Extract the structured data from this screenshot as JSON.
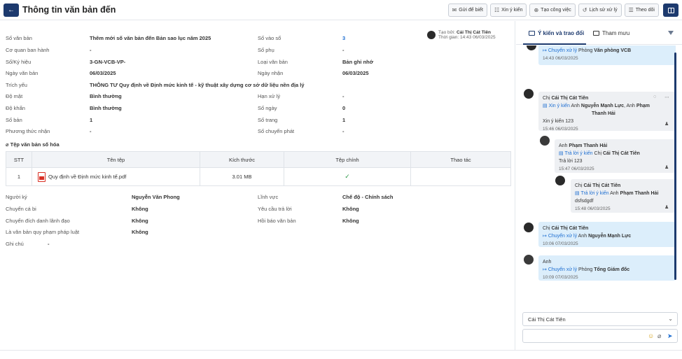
{
  "header": {
    "back_icon": "arrow-left-icon",
    "title": "Thông tin văn bản đến",
    "buttons": [
      {
        "label": "Gửi để biết",
        "icon": "send-icon"
      },
      {
        "label": "Xin ý kiến",
        "icon": "opinion-icon"
      },
      {
        "label": "Tạo công việc",
        "icon": "task-icon"
      },
      {
        "label": "Lịch sử xử lý",
        "icon": "history-icon"
      },
      {
        "label": "Theo dõi",
        "icon": "follow-icon"
      }
    ]
  },
  "creator": {
    "created_by_label": "Tạo bởi:",
    "created_by": "Cái Thị Cát Tiên",
    "time_label": "Thời gian:",
    "time": "14:43 06/03/2025"
  },
  "fields": {
    "so_van_ban": {
      "label": "Số văn bản",
      "value": "Thêm mới số văn bản đến Bản sao lục năm 2025"
    },
    "so_vao_so": {
      "label": "Số vào sổ",
      "value": "3"
    },
    "co_quan": {
      "label": "Cơ quan ban hành",
      "value": "-"
    },
    "so_phu": {
      "label": "Số phụ",
      "value": "-"
    },
    "ky_hieu": {
      "label": "Số/Ký hiệu",
      "value": "3-GN-VCB-VP-"
    },
    "loai_vb": {
      "label": "Loại văn bản",
      "value": "Bản ghi nhớ"
    },
    "ngay_vb": {
      "label": "Ngày văn bản",
      "value": "06/03/2025"
    },
    "ngay_nhan": {
      "label": "Ngày nhận",
      "value": "06/03/2025"
    },
    "trich_yeu": {
      "label": "Trích yếu",
      "value": "THÔNG TƯ Quy định về Định mức kinh tế - kỹ thuật xây dựng cơ sở dữ liệu nền địa lý"
    },
    "do_mat": {
      "label": "Độ mật",
      "value": "Bình thường"
    },
    "han_xu_ly": {
      "label": "Hạn xử lý",
      "value": "-"
    },
    "do_khan": {
      "label": "Độ khẩn",
      "value": "Bình thường"
    },
    "so_ngay": {
      "label": "Số ngày",
      "value": "0"
    },
    "so_ban": {
      "label": "Số bản",
      "value": "1"
    },
    "so_trang": {
      "label": "Số trang",
      "value": "1"
    },
    "phuong_thuc": {
      "label": "Phương thức nhận",
      "value": "-"
    },
    "so_chuyen_phat": {
      "label": "Số chuyển phát",
      "value": "-"
    },
    "nguoi_ky": {
      "label": "Người ký",
      "value": "Nguyễn Văn Phong"
    },
    "linh_vuc": {
      "label": "Lĩnh vực",
      "value": "Chế độ - Chính sách"
    },
    "chuyen_ca_bi": {
      "label": "Chuyển cá bi",
      "value": "Không"
    },
    "yeu_cau_tra_loi": {
      "label": "Yêu cầu trả lời",
      "value": "Không"
    },
    "chuyen_dich_danh": {
      "label": "Chuyển đích danh lãnh đạo",
      "value": "Không"
    },
    "hoi_bao": {
      "label": "Hồi báo văn bản",
      "value": "Không"
    },
    "qppl": {
      "label": "Là văn bản quy phạm pháp luật",
      "value": "Không"
    },
    "ghi_chu": {
      "label": "Ghi chú",
      "value": "-"
    }
  },
  "attachments": {
    "title": "Tệp văn bản số hóa",
    "columns": [
      "STT",
      "Tên tệp",
      "Kích thước",
      "Tệp chính",
      "Thao tác"
    ],
    "rows": [
      {
        "stt": "1",
        "name": "Quy định về Định mức kinh tế.pdf",
        "size": "3.01 MB",
        "main": true,
        "icon": "pdf-icon"
      }
    ]
  },
  "right_panel": {
    "tabs": [
      {
        "label": "Ý kiến và trao đổi",
        "active": true,
        "icon": "comment-icon"
      },
      {
        "label": "Tham mưu",
        "active": false,
        "icon": "advise-icon"
      }
    ],
    "messages": [
      {
        "sender": "",
        "action": "Chuyển xử lý",
        "target_prefix": "Phòng",
        "target": "Văn phòng VCB",
        "body": "",
        "time": "14:43 06/03/2025"
      },
      {
        "sender_prefix": "Chị",
        "sender": "Cái Thị Cát Tiên",
        "action": "Xin ý kiến",
        "target": "Anh Nguyễn Mạnh Lực, Anh Phạm Thanh Hải",
        "t1a": "Anh",
        "t1b": "Nguyễn Mạnh Lực",
        "t2a": "Anh",
        "t2b": "Phạm",
        "t2c": "Thanh Hải",
        "body": "Xin ý kiến 123",
        "time": "15:46 06/03/2025"
      },
      {
        "sender_prefix": "Anh",
        "sender": "Phạm Thanh Hải",
        "action": "Trả lời ý kiến",
        "target_prefix": "Chị",
        "target": "Cái Thị Cát Tiên",
        "body": "Trả lời 123",
        "time": "15:47 06/03/2025"
      },
      {
        "sender_prefix": "Chị",
        "sender": "Cái Thị Cát Tiên",
        "action": "Trả lời ý kiến",
        "target_prefix": "Anh",
        "target": "Phạm Thanh Hải",
        "body": "dsfsdgdf",
        "time": "15:48 06/03/2025"
      },
      {
        "sender_prefix": "Chị",
        "sender": "Cái Thị Cát Tiên",
        "action": "Chuyển xử lý",
        "target_prefix": "Anh",
        "target": "Nguyễn Mạnh Lực",
        "body": "",
        "time": "10:06 07/03/2025"
      },
      {
        "sender_prefix": "Anh",
        "sender": "",
        "action": "Chuyển xử lý",
        "target_prefix": "Phòng",
        "target": "Tổng Giám đốc",
        "body": "",
        "time": "10:09 07/03/2025"
      }
    ],
    "recipient_select": "Cái Thị Cát Tiên",
    "input_placeholder": ""
  },
  "colors": {
    "primary": "#1d3a6e",
    "link": "#1f6fd1",
    "bubble_blue": "#dceefb",
    "bubble_grey": "#eef0f3",
    "check": "#2e9a4a"
  }
}
